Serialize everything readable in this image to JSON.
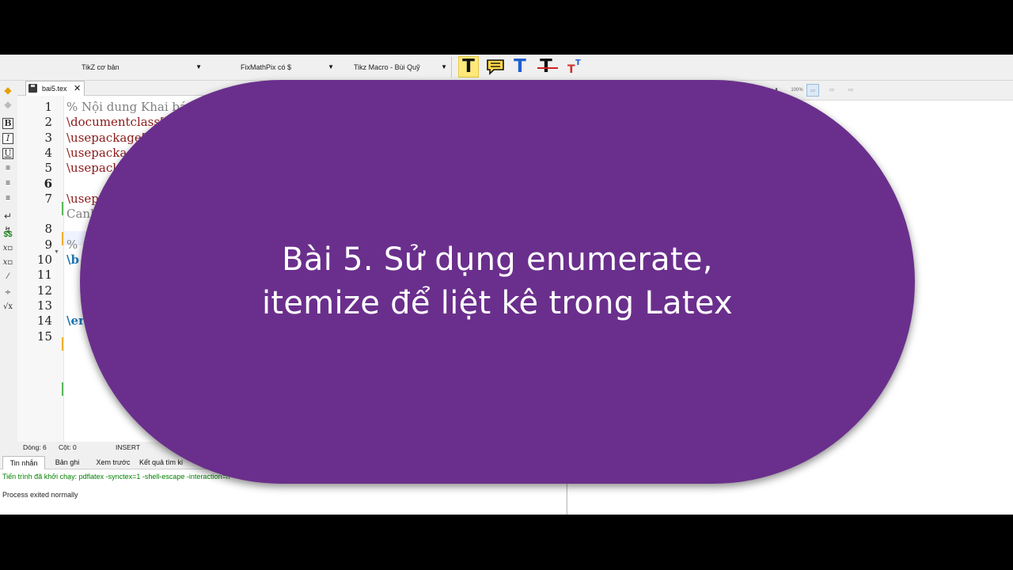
{
  "colors": {
    "accent_purple": "#6a2f8c",
    "comment": "#808080",
    "command": "#8b1a1a",
    "keyword": "#1d75b3",
    "log_green": "#008000"
  },
  "toolbar": {
    "combo1": "TikZ cơ bản",
    "combo2": "FixMathPix có $",
    "combo3": "Tikz Macro - Bùi Quỹ",
    "buttons": [
      {
        "glyph": "T",
        "icon": "text-highlight-icon"
      },
      {
        "glyph": "",
        "icon": "speech-bubble-icon"
      },
      {
        "glyph": "T",
        "icon": "text-color-icon"
      },
      {
        "glyph": "T",
        "icon": "strikethrough-icon"
      },
      {
        "glyph": "T",
        "icon": "superscript-icon"
      }
    ]
  },
  "sidebar": {
    "bold": "B",
    "italic": "I",
    "underline": "U",
    "dollar": "$$"
  },
  "tab": {
    "filename": "bai5.tex",
    "close": "✕"
  },
  "editor": {
    "line_numbers": [
      "1",
      "2",
      "3",
      "4",
      "5",
      "6",
      "7",
      "",
      "8",
      "9",
      "10",
      "11",
      "12",
      "13",
      "14",
      "15"
    ],
    "lines": [
      {
        "text": "% Nội dung Khai báo",
        "style": "comment"
      },
      {
        "text": "\\documentclass[",
        "style": "command"
      },
      {
        "text": "\\usepackage[",
        "style": "command"
      },
      {
        "text": "\\usepackag",
        "style": "command"
      },
      {
        "text": "\\usepack",
        "style": "command"
      },
      {
        "text": "",
        "style": "plain"
      },
      {
        "text": "\\usep",
        "style": "command"
      },
      {
        "text": "Canl",
        "style": "comment"
      },
      {
        "text": "",
        "style": "plain"
      },
      {
        "text": "% ",
        "style": "comment"
      },
      {
        "text": "\\b",
        "style": "keyword"
      },
      {
        "text": "",
        "style": "plain"
      },
      {
        "text": "",
        "style": "plain"
      },
      {
        "text": "",
        "style": "plain"
      },
      {
        "text": "\\er",
        "style": "keyword"
      },
      {
        "text": "",
        "style": "plain"
      }
    ]
  },
  "status": {
    "line": "Dòng: 6",
    "col": "Cột: 0",
    "mode": "INSERT"
  },
  "bottom_tabs": [
    "Tin nhắn",
    "Bản ghi",
    "Xem trước",
    "Kết quả tìm ki"
  ],
  "log": {
    "line1": "Tiến trình đã khởi chạy: pdflatex -synctex=1 -shell-escape -interaction=n",
    "line2": "Process exited normally"
  },
  "preview_toolbar": {
    "zoom_label": "100%"
  },
  "banner": {
    "line1": "Bài 5. Sử dụng enumerate,",
    "line2": "itemize để liệt kê trong Latex"
  }
}
